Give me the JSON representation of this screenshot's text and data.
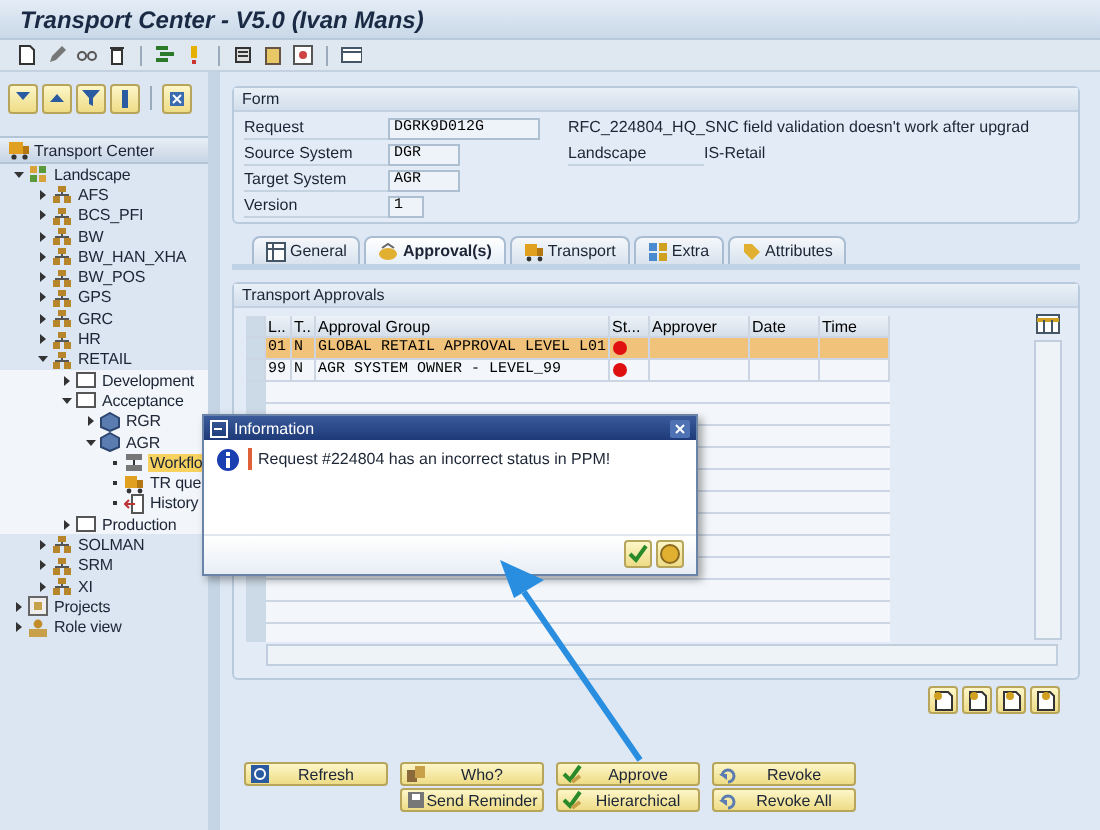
{
  "window": {
    "title": "Transport Center - V5.0 (Ivan Mans)"
  },
  "tree": {
    "title": "Transport Center",
    "items": [
      {
        "label": "Landscape",
        "kind": "landscape",
        "expanded": true,
        "selected": false,
        "children": [
          {
            "label": "AFS",
            "kind": "system",
            "expanded": false,
            "selected": false
          },
          {
            "label": "BCS_PFI",
            "kind": "system",
            "expanded": false,
            "selected": false
          },
          {
            "label": "BW",
            "kind": "system",
            "expanded": false,
            "selected": false
          },
          {
            "label": "BW_HAN_XHA",
            "kind": "system",
            "expanded": false,
            "selected": false
          },
          {
            "label": "BW_POS",
            "kind": "system",
            "expanded": false,
            "selected": false
          },
          {
            "label": "GPS",
            "kind": "system",
            "expanded": false,
            "selected": false
          },
          {
            "label": "GRC",
            "kind": "system",
            "expanded": false,
            "selected": false
          },
          {
            "label": "HR",
            "kind": "system",
            "expanded": false,
            "selected": false
          },
          {
            "label": "RETAIL",
            "kind": "system",
            "expanded": true,
            "selected": false,
            "children": [
              {
                "label": "Development",
                "kind": "stage",
                "expanded": false,
                "selected": false
              },
              {
                "label": "Acceptance",
                "kind": "stage",
                "expanded": true,
                "selected": false,
                "children": [
                  {
                    "label": "RGR",
                    "kind": "client",
                    "expanded": false,
                    "selected": false
                  },
                  {
                    "label": "AGR",
                    "kind": "client",
                    "expanded": true,
                    "selected": false,
                    "children": [
                      {
                        "label": "Workflo",
                        "kind": "workflow",
                        "selected": true
                      },
                      {
                        "label": "TR que",
                        "kind": "queue",
                        "selected": false
                      },
                      {
                        "label": "History",
                        "kind": "history",
                        "selected": false
                      }
                    ]
                  }
                ]
              },
              {
                "label": "Production",
                "kind": "stage",
                "expanded": false,
                "selected": false
              }
            ]
          },
          {
            "label": "SOLMAN",
            "kind": "system",
            "expanded": false,
            "selected": false
          },
          {
            "label": "SRM",
            "kind": "system",
            "expanded": false,
            "selected": false
          },
          {
            "label": "XI",
            "kind": "system",
            "expanded": false,
            "selected": false
          }
        ]
      },
      {
        "label": "Projects",
        "kind": "projects",
        "expanded": false,
        "selected": false
      },
      {
        "label": "Role view",
        "kind": "role",
        "expanded": false,
        "selected": false
      }
    ]
  },
  "form": {
    "title": "Form",
    "fields": [
      {
        "label": "Request",
        "value": "DGRK9D012G"
      },
      {
        "label": "Source System",
        "value": "DGR"
      },
      {
        "label": "Target System",
        "value": "AGR"
      },
      {
        "label": "Version",
        "value": "1"
      }
    ],
    "description": "RFC_224804_HQ_SNC field validation doesn't work after upgrad",
    "landscape_label": "Landscape",
    "landscape_value": "IS-Retail"
  },
  "tabs": [
    {
      "label": "General",
      "selected": false
    },
    {
      "label": "Approval(s)",
      "selected": true
    },
    {
      "label": "Transport",
      "selected": false
    },
    {
      "label": "Extra",
      "selected": false
    },
    {
      "label": "Attributes",
      "selected": false
    }
  ],
  "table": {
    "title": "Transport Approvals",
    "columns": [
      "L..",
      "T..",
      "Approval Group",
      "St...",
      "Approver",
      "Date",
      "Time"
    ],
    "rows": [
      {
        "level": "01",
        "type": "N",
        "group": "GLOBAL RETAIL APPROVAL LEVEL L01",
        "color": "#e01010",
        "selected": true
      },
      {
        "level": "99",
        "type": "N",
        "group": "AGR SYSTEM OWNER - LEVEL_99",
        "color": "#e01010",
        "selected": false
      }
    ]
  },
  "dialog": {
    "title": "Information",
    "message": "Request #224804 has an incorrect status in PPM!"
  },
  "buttons": [
    [
      "Refresh"
    ],
    [
      "Who?",
      "Send Reminder"
    ],
    [
      "Approve",
      "Hierarchical"
    ],
    [
      "Revoke",
      "Revoke All"
    ]
  ]
}
